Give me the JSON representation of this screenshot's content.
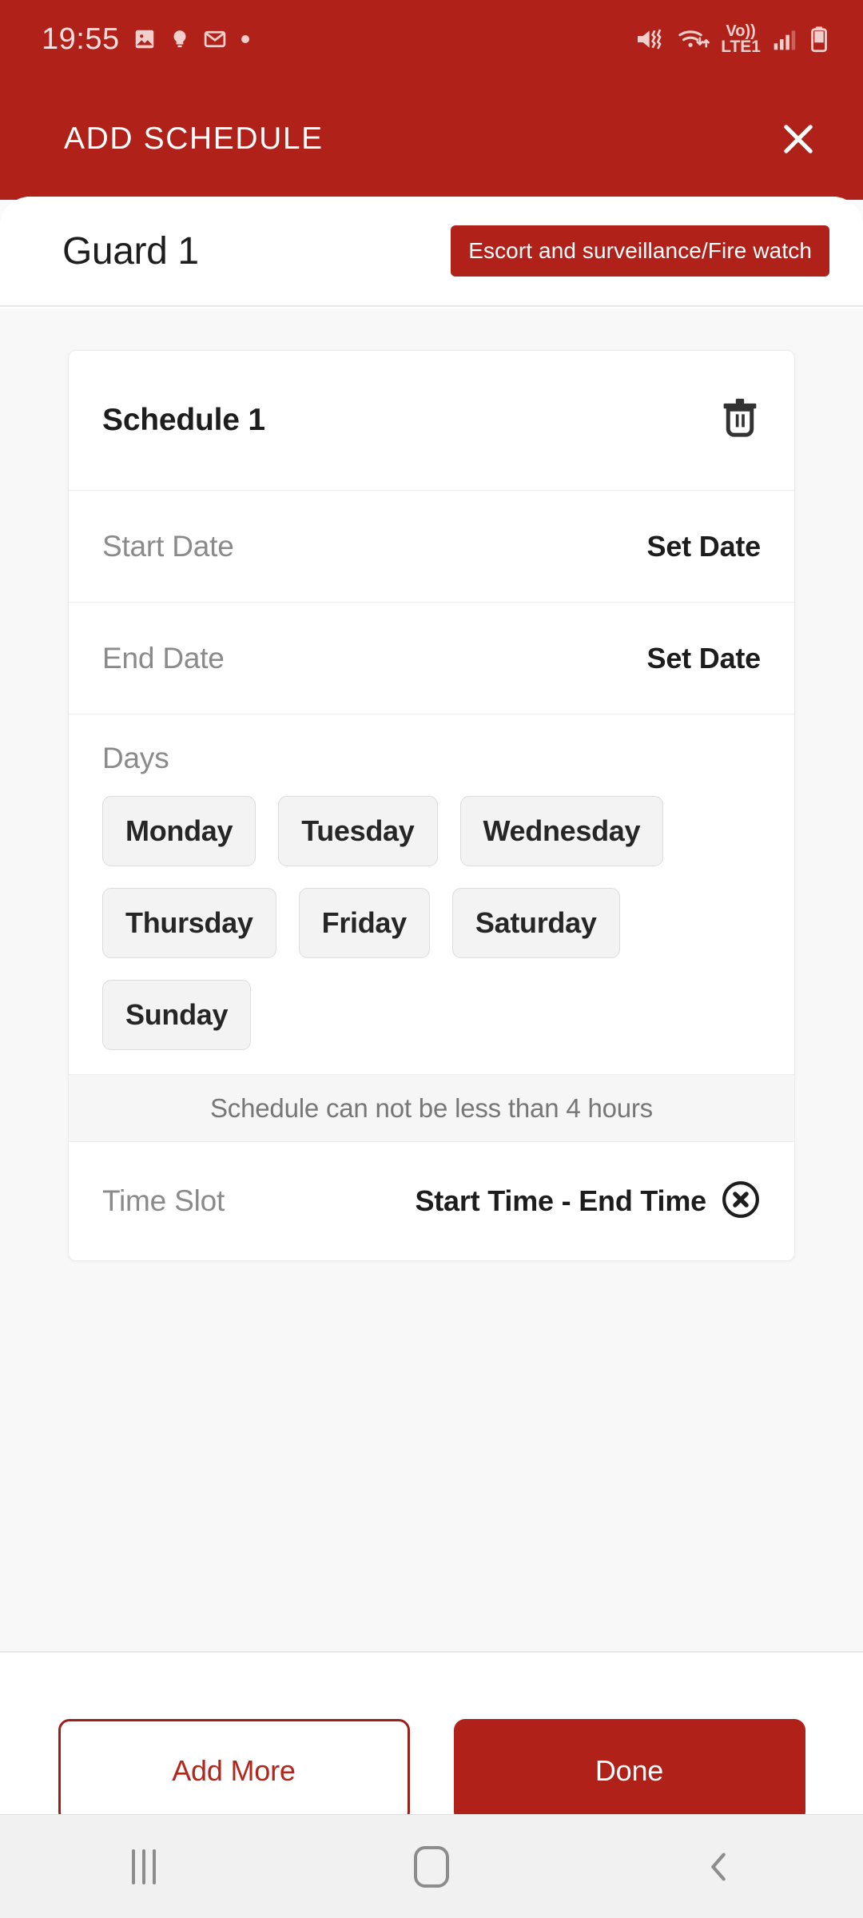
{
  "status_bar": {
    "time": "19:55",
    "left_icons": [
      "image-icon",
      "lightbulb-icon",
      "gmail-icon",
      "dot-icon"
    ],
    "network_label_top": "Vo))",
    "network_label_bottom": "LTE1",
    "right_icons": [
      "mute-vibrate-icon",
      "wifi-icon",
      "signal-bars-icon",
      "battery-icon"
    ]
  },
  "app_bar": {
    "title": "ADD SCHEDULE",
    "close_icon": "close-icon"
  },
  "sheet_header": {
    "guard_name": "Guard 1",
    "role_badge": "Escort and surveillance/Fire watch"
  },
  "schedule_card": {
    "title": "Schedule 1",
    "delete_icon": "trash-icon",
    "start_date": {
      "label": "Start Date",
      "value": "Set Date"
    },
    "end_date": {
      "label": "End Date",
      "value": "Set Date"
    },
    "days": {
      "label": "Days",
      "options": [
        "Monday",
        "Tuesday",
        "Wednesday",
        "Thursday",
        "Friday",
        "Saturday",
        "Sunday"
      ]
    },
    "warning": "Schedule can not be less than 4 hours",
    "time_slot": {
      "label": "Time Slot",
      "value": "Start Time - End Time",
      "clear_icon": "circle-x-icon"
    }
  },
  "footer": {
    "add_more_label": "Add More",
    "done_label": "Done"
  },
  "nav_bar": {
    "recents_icon": "recents-icon",
    "home_icon": "home-icon",
    "back_icon": "back-icon"
  },
  "colors": {
    "brand_red": "#AF2119",
    "outline_red": "#b3261c",
    "body_bg": "#f8f8f8",
    "chip_bg": "#f3f3f3"
  }
}
